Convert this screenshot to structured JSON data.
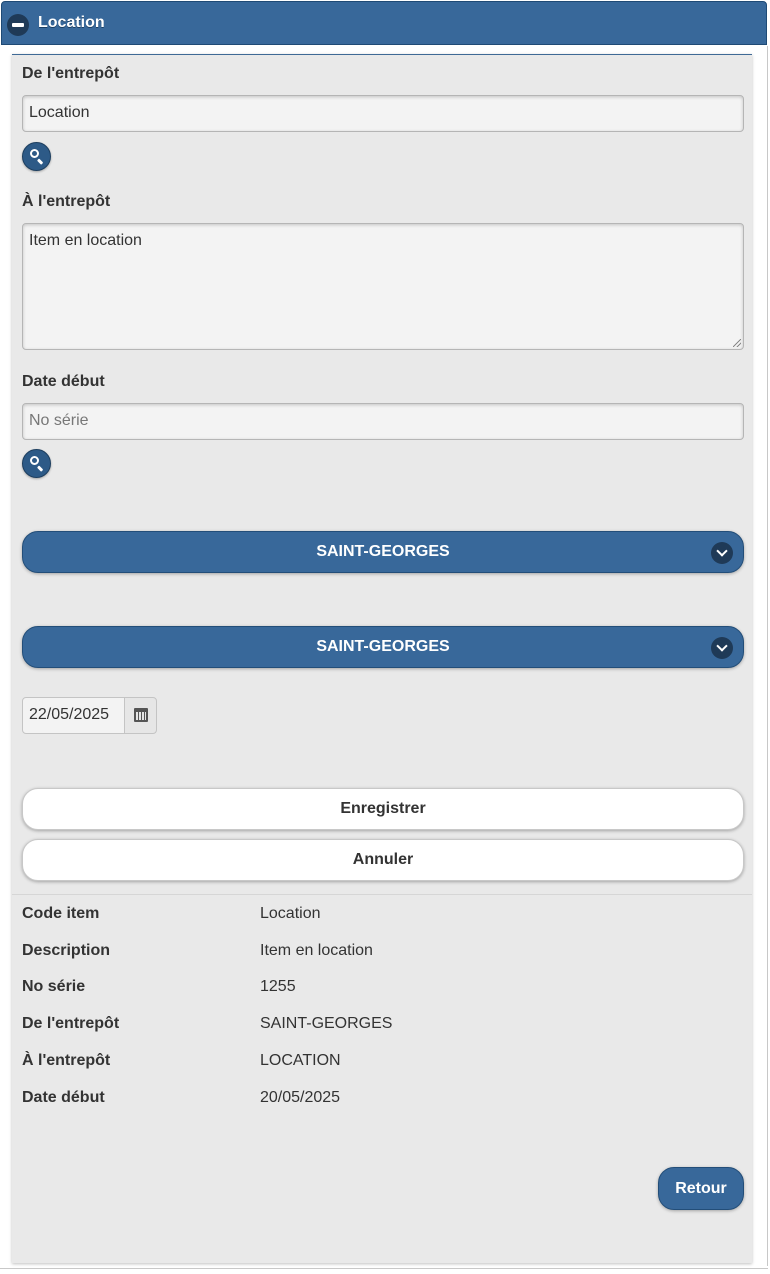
{
  "header": {
    "title": "Location"
  },
  "form": {
    "from_warehouse": {
      "label": "De l'entrepôt",
      "value": "Location"
    },
    "to_warehouse": {
      "label": "À l'entrepôt",
      "value": "Item en location"
    },
    "start_date": {
      "label": "Date début",
      "placeholder": "No série"
    },
    "select_1": {
      "value": "SAINT-GEORGES"
    },
    "select_2": {
      "value": "SAINT-GEORGES"
    },
    "date_value": "22/05/2025",
    "save_label": "Enregistrer",
    "cancel_label": "Annuler"
  },
  "details": [
    {
      "key": "Code item",
      "value": "Location"
    },
    {
      "key": "Description",
      "value": "Item en location"
    },
    {
      "key": "No série",
      "value": "1255"
    },
    {
      "key": "De l'entrepôt",
      "value": "SAINT-GEORGES"
    },
    {
      "key": "À l'entrepôt",
      "value": "LOCATION"
    },
    {
      "key": "Date début",
      "value": "20/05/2025"
    }
  ],
  "back_label": "Retour",
  "icons": {
    "collapse": "minus-circle-icon",
    "search": "search-icon",
    "chevron": "chevron-down-icon",
    "calendar": "calendar-icon"
  },
  "colors": {
    "primary": "#38689a",
    "primary_dark": "#1f3a57",
    "panel_bg": "#e9e9e9"
  }
}
